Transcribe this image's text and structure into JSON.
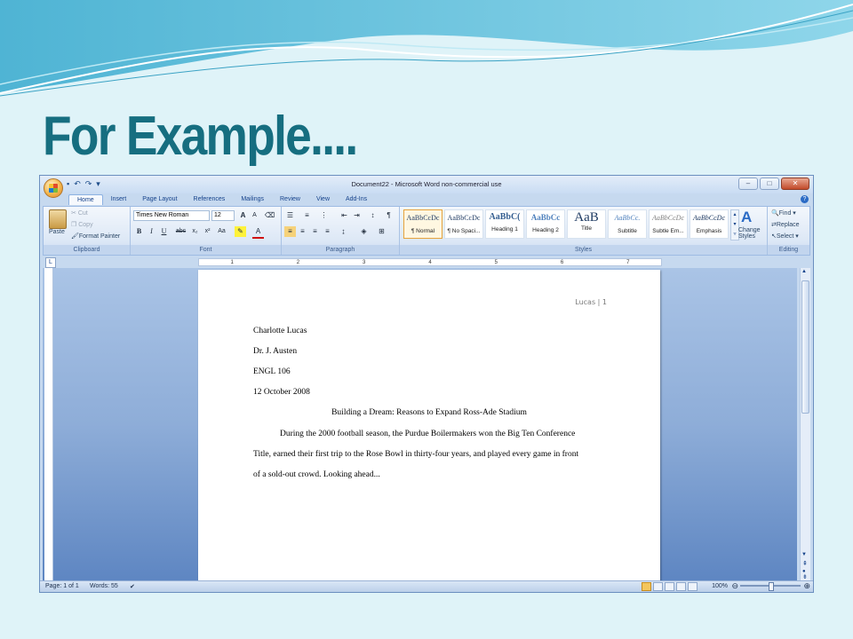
{
  "slide": {
    "title": "For Example...."
  },
  "window": {
    "title": "Document22 - Microsoft Word non-commercial use"
  },
  "tabs": [
    {
      "label": "Home"
    },
    {
      "label": "Insert"
    },
    {
      "label": "Page Layout"
    },
    {
      "label": "References"
    },
    {
      "label": "Mailings"
    },
    {
      "label": "Review"
    },
    {
      "label": "View"
    },
    {
      "label": "Add-Ins"
    }
  ],
  "clipboard": {
    "paste": "Paste",
    "cut": "Cut",
    "copy": "Copy",
    "format_painter": "Format Painter",
    "label": "Clipboard"
  },
  "font": {
    "name": "Times New Roman",
    "size": "12",
    "label": "Font"
  },
  "paragraph": {
    "label": "Paragraph"
  },
  "styles": {
    "label": "Styles",
    "items": [
      {
        "sample": "AaBbCcDc",
        "name": "¶ Normal"
      },
      {
        "sample": "AaBbCcDc",
        "name": "¶ No Spaci..."
      },
      {
        "sample": "AaBbC(",
        "name": "Heading 1"
      },
      {
        "sample": "AaBbCc",
        "name": "Heading 2"
      },
      {
        "sample": "AaB",
        "name": "Title"
      },
      {
        "sample": "AaBbCc.",
        "name": "Subtitle"
      },
      {
        "sample": "AaBbCcDc",
        "name": "Subtle Em..."
      },
      {
        "sample": "AaBbCcDc",
        "name": "Emphasis"
      }
    ],
    "change_line1": "Change",
    "change_line2": "Styles"
  },
  "editing": {
    "find": "Find",
    "replace": "Replace",
    "select": "Select",
    "label": "Editing"
  },
  "ruler": {
    "numbers": [
      "1",
      "2",
      "3",
      "4",
      "5",
      "6",
      "7"
    ]
  },
  "document": {
    "header": "Lucas | 1",
    "lines": [
      "Charlotte Lucas",
      "Dr. J. Austen",
      "ENGL 106",
      "12 October 2008"
    ],
    "title": "Building a Dream: Reasons to Expand Ross-Ade Stadium",
    "body": [
      "During the 2000 football season, the Purdue Boilermakers  won the Big Ten Conference",
      "Title, earned their first trip to the Rose Bowl in thirty-four years, and played every game in front",
      "of a sold-out crowd.  Looking ahead..."
    ]
  },
  "status": {
    "page": "Page: 1 of 1",
    "words": "Words: 55",
    "zoom": "100%"
  }
}
